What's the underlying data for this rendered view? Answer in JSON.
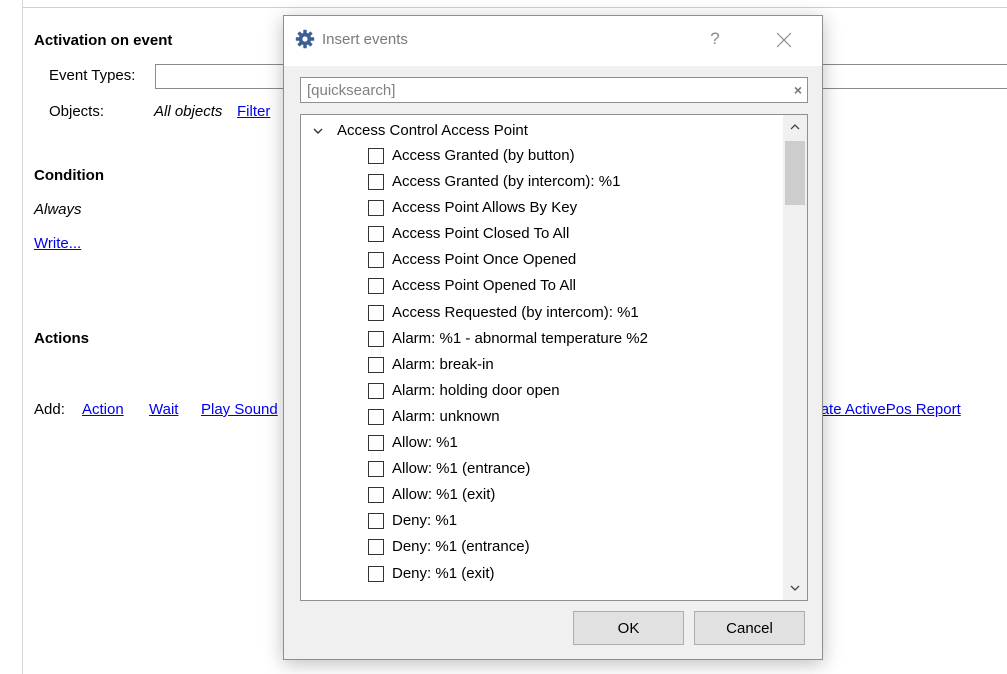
{
  "background": {
    "activation_heading": "Activation on event",
    "event_types_label": "Event Types:",
    "objects_label": "Objects:",
    "objects_value": "All objects",
    "filter_link": "Filter",
    "condition_heading": "Condition",
    "condition_value": "Always",
    "write_link": "Write...",
    "actions_heading": "Actions",
    "add_label": "Add:",
    "add_links": [
      "Action",
      "Wait",
      "Play Sound",
      "Generate ActivePos Report"
    ]
  },
  "dialog": {
    "title": "Insert events",
    "help_label": "?",
    "search_placeholder": "[quicksearch]",
    "search_clear": "×",
    "group_label": "Access Control Access Point",
    "items": [
      "Access Granted (by button)",
      "Access Granted (by intercom): %1",
      "Access Point Allows By Key",
      "Access Point Closed To All",
      "Access Point Once Opened",
      "Access Point Opened To All",
      "Access Requested (by intercom): %1",
      "Alarm: %1 - abnormal temperature %2",
      "Alarm: break-in",
      "Alarm: holding door open",
      "Alarm: unknown",
      "Allow: %1",
      "Allow: %1 (entrance)",
      "Allow: %1 (exit)",
      "Deny: %1",
      "Deny: %1 (entrance)",
      "Deny: %1 (exit)"
    ],
    "ok_label": "OK",
    "cancel_label": "Cancel"
  },
  "icons": {
    "dialog_icon": "gear-icon",
    "close": "close-icon",
    "expand": "chevron-down-icon"
  },
  "colors": {
    "link": "#0000ee",
    "dialog_bg": "#f0f0f0",
    "gear_icon": "#3a5f94"
  }
}
